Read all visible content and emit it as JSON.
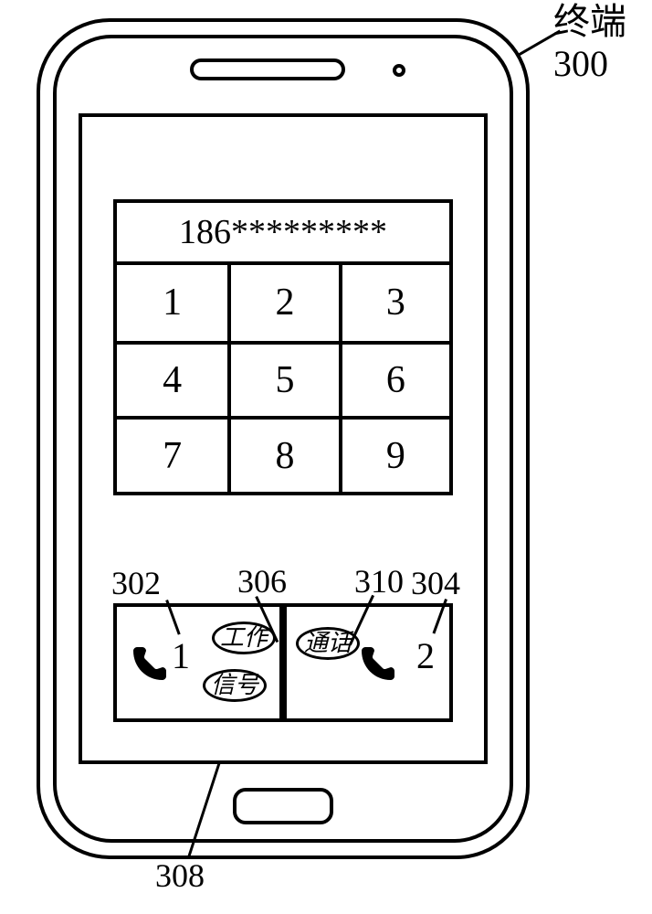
{
  "label": {
    "text": "终端",
    "ref": "300"
  },
  "dialer": {
    "display": "186*********",
    "keys": [
      "1",
      "2",
      "3",
      "4",
      "5",
      "6",
      "7",
      "8",
      "9"
    ]
  },
  "sim": {
    "left": {
      "num": "1",
      "tags": {
        "work": "工作",
        "signal": "信号"
      }
    },
    "right": {
      "num": "2",
      "tags": {
        "call": "通话"
      }
    }
  },
  "refs": {
    "r302": "302",
    "r304": "304",
    "r306": "306",
    "r308": "308",
    "r310": "310"
  }
}
